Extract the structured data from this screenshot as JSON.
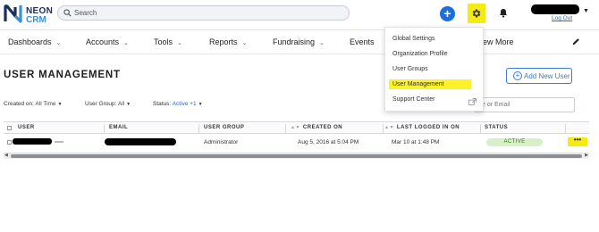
{
  "brand": {
    "line1": "NEON",
    "line2": "CRM"
  },
  "header": {
    "search_placeholder": "Search",
    "add_label": "+",
    "logout_label": "Log Out"
  },
  "nav": {
    "items": [
      {
        "label": "Dashboards",
        "chevron": "⌄"
      },
      {
        "label": "Accounts",
        "chevron": "⌄"
      },
      {
        "label": "Tools",
        "chevron": "⌄"
      },
      {
        "label": "Reports",
        "chevron": "⌄"
      },
      {
        "label": "Fundraising",
        "chevron": "⌄"
      },
      {
        "label": "Events",
        "chevron": ""
      },
      {
        "label": "ew More",
        "chevron": ""
      }
    ]
  },
  "settings_menu": {
    "items": [
      {
        "label": "Global Settings"
      },
      {
        "label": "Organization Profile"
      },
      {
        "label": "User Groups"
      },
      {
        "label": "User Management",
        "highlighted": true
      },
      {
        "label": "Support Center",
        "icon": "external-link-icon"
      }
    ]
  },
  "page": {
    "title": "USER MANAGEMENT",
    "add_button": "Add New User",
    "search_placeholder": "e or Email"
  },
  "filters": {
    "created_on": {
      "label": "Created on:",
      "value": "All Time"
    },
    "user_group": {
      "label": "User Group:",
      "value": "All"
    },
    "status": {
      "label": "Status:",
      "value": "Active +1"
    }
  },
  "table": {
    "columns": [
      "USER",
      "EMAIL",
      "USER GROUP",
      "CREATED ON",
      "LAST LOGGED IN ON",
      "STATUS"
    ],
    "rows": [
      {
        "user_group": "Administrator",
        "created_on": "Aug 5, 2016 at 5:04 PM",
        "last_logged_in": "Mar 10 at 1:48 PM",
        "status": "ACTIVE",
        "actions": "•••"
      }
    ]
  },
  "colors": {
    "accent_blue": "#1b6fe0",
    "highlight_yellow": "#f5ea13",
    "status_active_bg": "#d7f0c8",
    "brand_navy": "#1c2e5a"
  }
}
